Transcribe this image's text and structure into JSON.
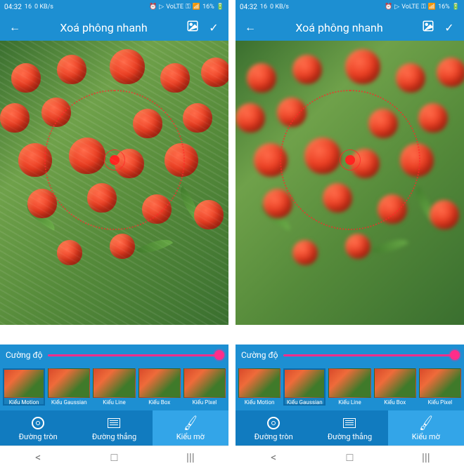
{
  "statusbar": {
    "time": "04:32",
    "net": "16",
    "kbs": "0 KB/s",
    "battery": "16%"
  },
  "appbar": {
    "title": "Xoá phông nhanh"
  },
  "slider": {
    "label": "Cường độ"
  },
  "styles": [
    {
      "label": "Kiểu Motion"
    },
    {
      "label": "Kiểu Gaussian"
    },
    {
      "label": "Kiểu Line"
    },
    {
      "label": "Kiểu Box"
    },
    {
      "label": "Kiểu Pixel"
    }
  ],
  "tabs": [
    {
      "label": "Đường tròn"
    },
    {
      "label": "Đường thẳng"
    },
    {
      "label": "Kiểu mờ"
    }
  ],
  "selected": {
    "left_style": 0,
    "right_style": 1,
    "active_tab": 2
  }
}
